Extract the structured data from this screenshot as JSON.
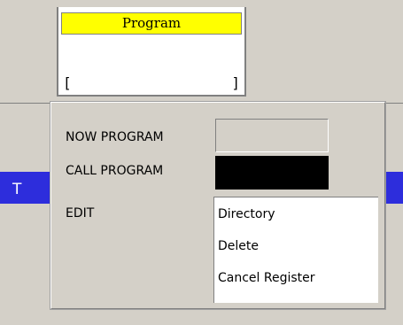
{
  "program_box": {
    "title": "Program",
    "field_open": "[",
    "field_close": "]"
  },
  "background": {
    "strip_text": "T"
  },
  "dialog": {
    "now_program_label": "NOW PROGRAM",
    "call_program_label": "CALL PROGRAM",
    "edit_label": "EDIT",
    "edit_items": [
      "Directory",
      "Delete",
      "Cancel Register"
    ]
  },
  "colors": {
    "title_bar": "#ffff00",
    "strip": "#2d2ddc",
    "panel": "#d4d0c8"
  }
}
